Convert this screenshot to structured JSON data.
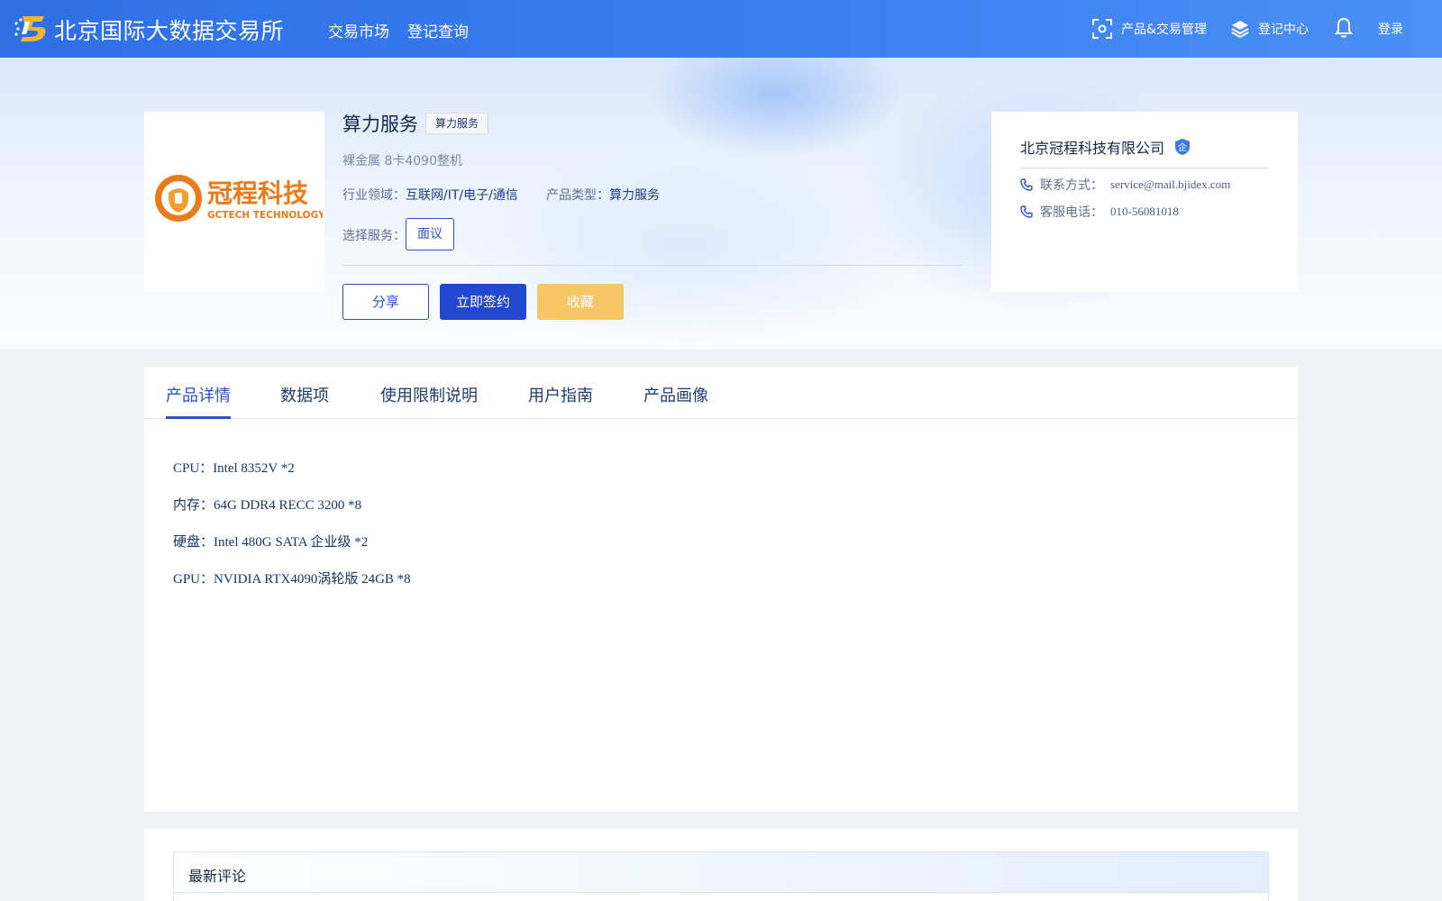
{
  "header": {
    "site_title": "北京国际大数据交易所",
    "nav": [
      "交易市场",
      "登记查询"
    ],
    "product_mgmt": "产品&交易管理",
    "register_center": "登记中心",
    "login": "登录",
    "colors": {
      "bar_start": "#2f6fe6",
      "bar_end": "#4a90f5"
    }
  },
  "product": {
    "title": "算力服务",
    "tag": "算力服务",
    "subtitle": "裸金属 8卡4090整机",
    "industry_label": "行业领域：",
    "industry_value": "互联网/IT/电子/通信",
    "type_label": "产品类型：",
    "type_value": "算力服务",
    "service_label": "选择服务：",
    "service_option": "面议",
    "logo_text": "冠程科技",
    "logo_sub": "GCTECH TECHNOLOGY",
    "actions": {
      "share": "分享",
      "sign": "立即签约",
      "favorite": "收藏"
    }
  },
  "seller": {
    "name": "北京冠程科技有限公司",
    "badge": "企",
    "contact_label": "联系方式：",
    "contact_value": "service@mail.bjidex.com",
    "phone_label": "客服电话：",
    "phone_value": "010-56081018"
  },
  "tabs": {
    "items": [
      "产品详情",
      "数据项",
      "使用限制说明",
      "用户指南",
      "产品画像"
    ],
    "active": "产品详情"
  },
  "details": [
    "CPU：Intel 8352V *2",
    "内存：64G DDR4 RECC 3200 *8",
    "硬盘：Intel 480G SATA 企业级 *2",
    "GPU：NVIDIA RTX4090涡轮版 24GB *8"
  ],
  "comments": {
    "title": "最新评论"
  },
  "colors": {
    "accent": "#2c50c7",
    "primary_button": "#2248d0",
    "favorite_button": "#f5c765",
    "logo_orange": "#ea7a1a"
  },
  "icons": [
    "brand-logo",
    "scan-icon",
    "layers-icon",
    "bell-icon",
    "verified-shield-icon",
    "phone-icon"
  ]
}
